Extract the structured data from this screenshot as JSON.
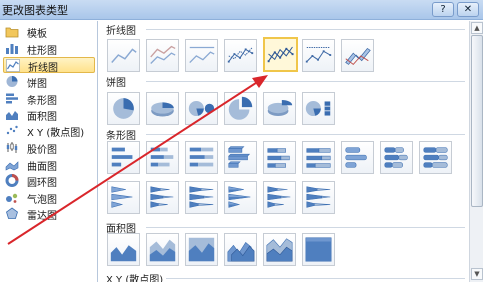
{
  "window": {
    "title": "更改图表类型",
    "buttons": [
      {
        "icon": "help-icon",
        "glyph": "?"
      },
      {
        "icon": "close-icon",
        "glyph": "✕"
      }
    ]
  },
  "categories": [
    {
      "label": "模板",
      "icon": "folder-icon",
      "selected": false
    },
    {
      "label": "柱形图",
      "icon": "column-chart-icon",
      "selected": false
    },
    {
      "label": "折线图",
      "icon": "line-chart-icon",
      "selected": true
    },
    {
      "label": "饼图",
      "icon": "pie-chart-icon",
      "selected": false
    },
    {
      "label": "条形图",
      "icon": "bar-chart-icon",
      "selected": false
    },
    {
      "label": "面积图",
      "icon": "area-chart-icon",
      "selected": false
    },
    {
      "label": "X Y (散点图)",
      "icon": "scatter-chart-icon",
      "selected": false
    },
    {
      "label": "股价图",
      "icon": "stock-chart-icon",
      "selected": false
    },
    {
      "label": "曲面图",
      "icon": "surface-chart-icon",
      "selected": false
    },
    {
      "label": "圆环图",
      "icon": "doughnut-chart-icon",
      "selected": false
    },
    {
      "label": "气泡图",
      "icon": "bubble-chart-icon",
      "selected": false
    },
    {
      "label": "雷达图",
      "icon": "radar-chart-icon",
      "selected": false
    }
  ],
  "sections": {
    "line": {
      "title": "折线图",
      "selected_index": 4
    },
    "pie": {
      "title": "饼图"
    },
    "bar": {
      "title": "条形图"
    },
    "area": {
      "title": "面积图"
    },
    "scatter": {
      "title": "X Y (散点图)"
    }
  },
  "colors": {
    "accent_selected": "#f0c64a",
    "annotation_arrow": "#d9262b",
    "chart_blue": "#4f7fbf"
  }
}
